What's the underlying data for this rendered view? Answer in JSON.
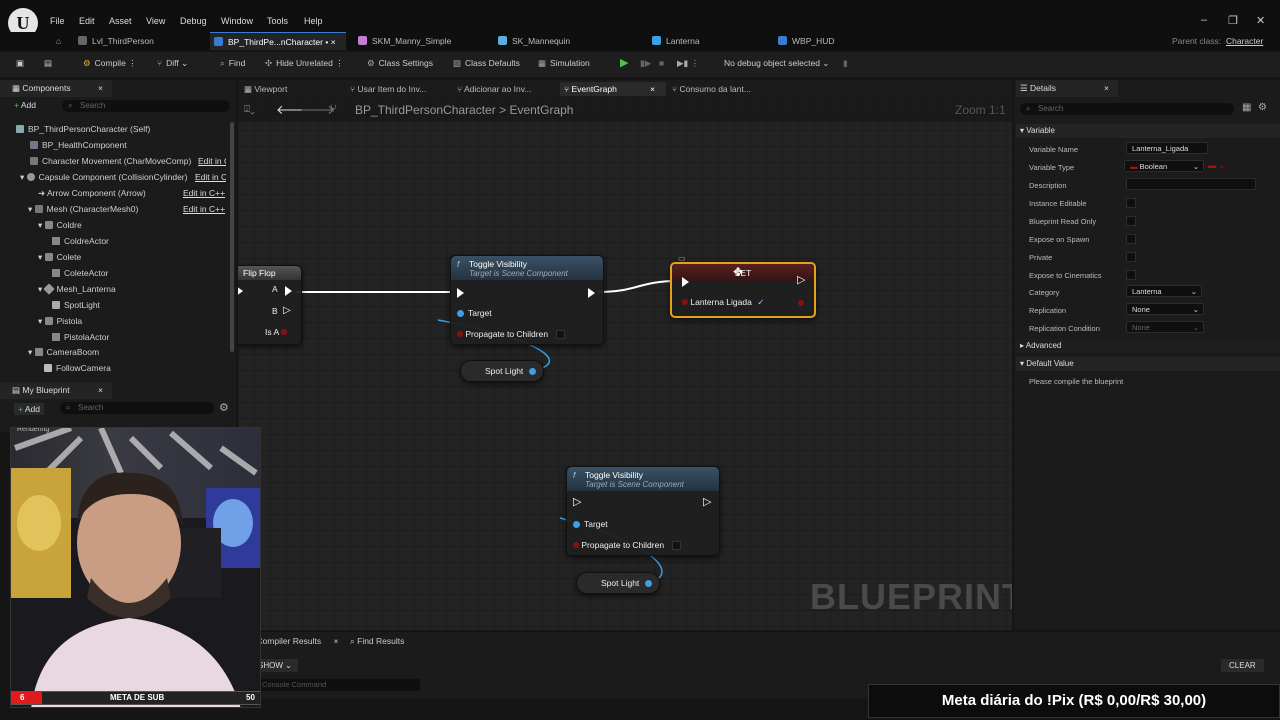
{
  "menu": {
    "items": [
      "File",
      "Edit",
      "Asset",
      "View",
      "Debug",
      "Window",
      "Tools",
      "Help"
    ]
  },
  "tabs": [
    {
      "label": "Lvl_ThirdPerson"
    },
    {
      "label": "BP_ThirdPe...nCharacter",
      "modified": "•",
      "close": "×"
    },
    {
      "label": "SKM_Manny_Simple"
    },
    {
      "label": "SK_Mannequin"
    },
    {
      "label": "Lanterna"
    },
    {
      "label": "WBP_HUD"
    }
  ],
  "parent_class": {
    "label": "Parent class:",
    "value": "Character"
  },
  "toolbar": {
    "compile": "Compile",
    "diff": "Diff",
    "find": "Find",
    "hide_unrelated": "Hide Unrelated",
    "class_settings": "Class Settings",
    "class_defaults": "Class Defaults",
    "simulation": "Simulation",
    "debug_object": "No debug object selected"
  },
  "components": {
    "title": "Components",
    "add": "Add",
    "search_placeholder": "Search",
    "items": [
      {
        "label": "BP_ThirdPersonCharacter (Self)",
        "edit": ""
      },
      {
        "label": "BP_HealthComponent",
        "edit": ""
      },
      {
        "label": "Character Movement (CharMoveComp)",
        "edit": "Edit in C++"
      },
      {
        "label": "Capsule Component (CollisionCylinder)",
        "edit": "Edit in C++"
      },
      {
        "label": "Arrow Component (Arrow)",
        "edit": "Edit in C++"
      },
      {
        "label": "Mesh (CharacterMesh0)",
        "edit": "Edit in C++"
      },
      {
        "label": "Coldre",
        "edit": ""
      },
      {
        "label": "ColdreActor",
        "edit": ""
      },
      {
        "label": "Colete",
        "edit": ""
      },
      {
        "label": "ColeteActor",
        "edit": ""
      },
      {
        "label": "Mesh_Lanterna",
        "edit": ""
      },
      {
        "label": "SpotLight",
        "edit": ""
      },
      {
        "label": "Pistola",
        "edit": ""
      },
      {
        "label": "PistolaActor",
        "edit": ""
      },
      {
        "label": "CameraBoom",
        "edit": ""
      },
      {
        "label": "FollowCamera",
        "edit": ""
      }
    ]
  },
  "my_blueprint": {
    "title": "My Blueprint",
    "add": "Add",
    "search_placeholder": "Search",
    "section": "Rendering"
  },
  "graph_tabs": [
    "Viewport",
    "Usar Item do Inv...",
    "Adicionar ao Inv...",
    "EventGraph",
    "Consumo da lant..."
  ],
  "breadcrumb": {
    "blueprint": "BP_ThirdPersonCharacter",
    "separator": ">",
    "graph": "EventGraph"
  },
  "zoom": "Zoom 1:1",
  "watermark": "BLUEPRINT",
  "nodes": {
    "flipflop": {
      "title": "Flip Flop",
      "pins": [
        "A",
        "B",
        "Is A"
      ]
    },
    "toggle1": {
      "title": "Toggle Visibility",
      "subtitle": "Target is Scene Component",
      "target": "Target",
      "propagate": "Propagate to Children"
    },
    "spot1": {
      "label": "Spot Light"
    },
    "setnode": {
      "title": "SET",
      "var": "Lanterna Ligada",
      "check": "✓"
    },
    "toggle2": {
      "title": "Toggle Visibility",
      "subtitle": "Target is Scene Component",
      "target": "Target",
      "propagate": "Propagate to Children"
    },
    "spot2": {
      "label": "Spot Light"
    }
  },
  "details": {
    "title": "Details",
    "search_placeholder": "Search",
    "section_variable": "Variable",
    "rows": {
      "variable_name": {
        "label": "Variable Name",
        "value": "Lanterna_Ligada"
      },
      "variable_type": {
        "label": "Variable Type",
        "value": "Boolean"
      },
      "description": {
        "label": "Description"
      },
      "instance_editable": {
        "label": "Instance Editable"
      },
      "read_only": {
        "label": "Blueprint Read Only"
      },
      "expose_spawn": {
        "label": "Expose on Spawn"
      },
      "private": {
        "label": "Private"
      },
      "expose_cinematics": {
        "label": "Expose to Cinematics"
      },
      "category": {
        "label": "Category",
        "value": "Lanterna"
      },
      "replication": {
        "label": "Replication",
        "value": "None"
      },
      "replication_condition": {
        "label": "Replication Condition",
        "value": "None"
      }
    },
    "advanced": "Advanced",
    "default_value": "Default Value",
    "compile_msg": "Please compile the blueprint"
  },
  "bottom": {
    "compiler_results": "Compiler Results",
    "find_results": "Find Results",
    "show": "SHOW",
    "console_placeholder": "Console Command",
    "clear": "CLEAR"
  },
  "overlay": {
    "sub_left": "6",
    "sub_label": "META DE SUB",
    "sub_right": "50",
    "pix": "Meta diária do !Pix (R$ 0,00/R$ 30,00)",
    "webcam_banner": "Rendering"
  }
}
